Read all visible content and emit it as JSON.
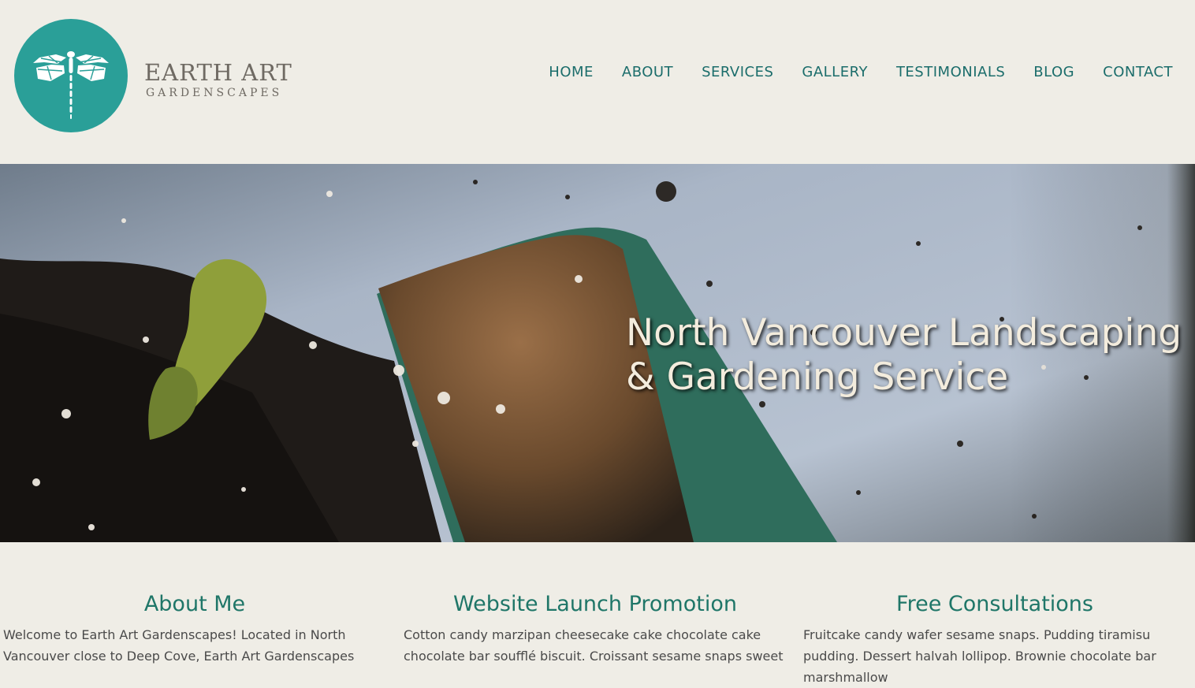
{
  "brand": {
    "title": "EARTH ART",
    "subtitle": "GARDENSCAPES",
    "logo_icon": "dragonfly-icon",
    "accent_color": "#2a9f98"
  },
  "nav": {
    "items": [
      {
        "label": "HOME"
      },
      {
        "label": "ABOUT"
      },
      {
        "label": "SERVICES"
      },
      {
        "label": "GALLERY"
      },
      {
        "label": "TESTIMONIALS"
      },
      {
        "label": "BLOG"
      },
      {
        "label": "CONTACT"
      }
    ],
    "color": "#1b6d6b"
  },
  "hero": {
    "title": "North Vancouver Landscaping & Gardening Service",
    "image": "garden-trowel-soil-photo"
  },
  "sections": [
    {
      "heading": "About Me",
      "body": "Welcome to Earth Art Gardenscapes! Located in North Vancouver close to Deep Cove, Earth Art Gardenscapes"
    },
    {
      "heading": "Website Launch Promotion",
      "body": "Cotton candy marzipan cheesecake cake chocolate cake chocolate bar soufflé biscuit. Croissant sesame snaps sweet"
    },
    {
      "heading": "Free Consultations",
      "body": "Fruitcake candy wafer sesame snaps. Pudding tiramisu pudding. Dessert halvah lollipop. Brownie chocolate bar marshmallow"
    }
  ]
}
